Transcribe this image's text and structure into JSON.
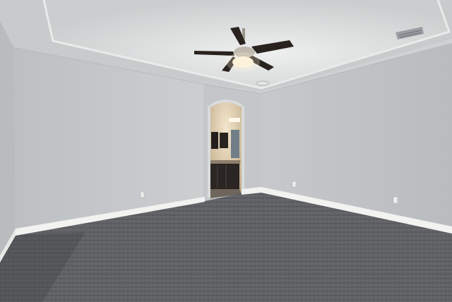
{
  "scene": {
    "subject": "empty room",
    "colors": {
      "ceiling": "#dcdedf",
      "tray_ceiling": "#d8dadb",
      "wall_left": "#c4c7ca",
      "wall_back": "#c9cbcd",
      "wall_right": "#bec1c4",
      "carpet": "#5c5e62",
      "carpet_dark": "#46484c",
      "baseboard": "#f4f4f2",
      "door_frame": "#cfd1d2",
      "bathroom_wall": "#cdb89a",
      "cabinet": "#2b2623",
      "fan_blade": "#2a221e",
      "fan_body": "#bfb8ae",
      "light_glow": "#fbf1d8"
    }
  }
}
